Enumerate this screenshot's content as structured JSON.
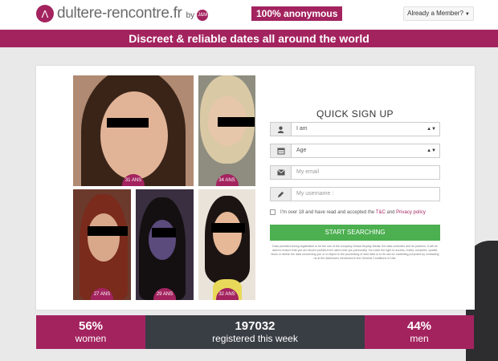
{
  "header": {
    "logo_icon": "Λ",
    "logo_text": "dultere-rencontre.fr",
    "logo_by": "by",
    "logo_badge": "J&M",
    "anonymous_label": "100% anonymous",
    "member_label": "Already a Member?"
  },
  "banner": {
    "text": "Discreet & reliable dates all around the world"
  },
  "profiles": [
    {
      "age": "31 ANS"
    },
    {
      "age": "34 ANS"
    },
    {
      "age": "27 ANS"
    },
    {
      "age": "29 ANS"
    },
    {
      "age": "32 ANS"
    }
  ],
  "form": {
    "title": "QUICK SIGN UP",
    "gender_value": "I am",
    "age_value": "Age",
    "email_placeholder": "My email",
    "username_placeholder": "My username :",
    "terms_prefix": "I'm over 18 and have read and accepted the",
    "terms_link": "T&C",
    "terms_and": "and",
    "privacy_link": "Privacy policy",
    "submit_label": "START SEARCHING",
    "fine_print": "Data provided during registration is for the use of the company Global Display Media, the data controller and its partners. It will be used to ensure that you are shown profiles from users near you personally. You have the right to access, rectify, complete, update, block or delete the data concerning you or to object to the processing of said data or to its use for marketing purposes by contacting us at the addresses mentioned in the General Conditions of Use."
  },
  "stats": [
    {
      "value": "56%",
      "label": "women"
    },
    {
      "value": "197032",
      "label": "registered this week"
    },
    {
      "value": "44%",
      "label": "men"
    }
  ],
  "colors": {
    "brand": "#a3235f",
    "cta": "#4caf50",
    "stat_dark": "#393d44"
  }
}
